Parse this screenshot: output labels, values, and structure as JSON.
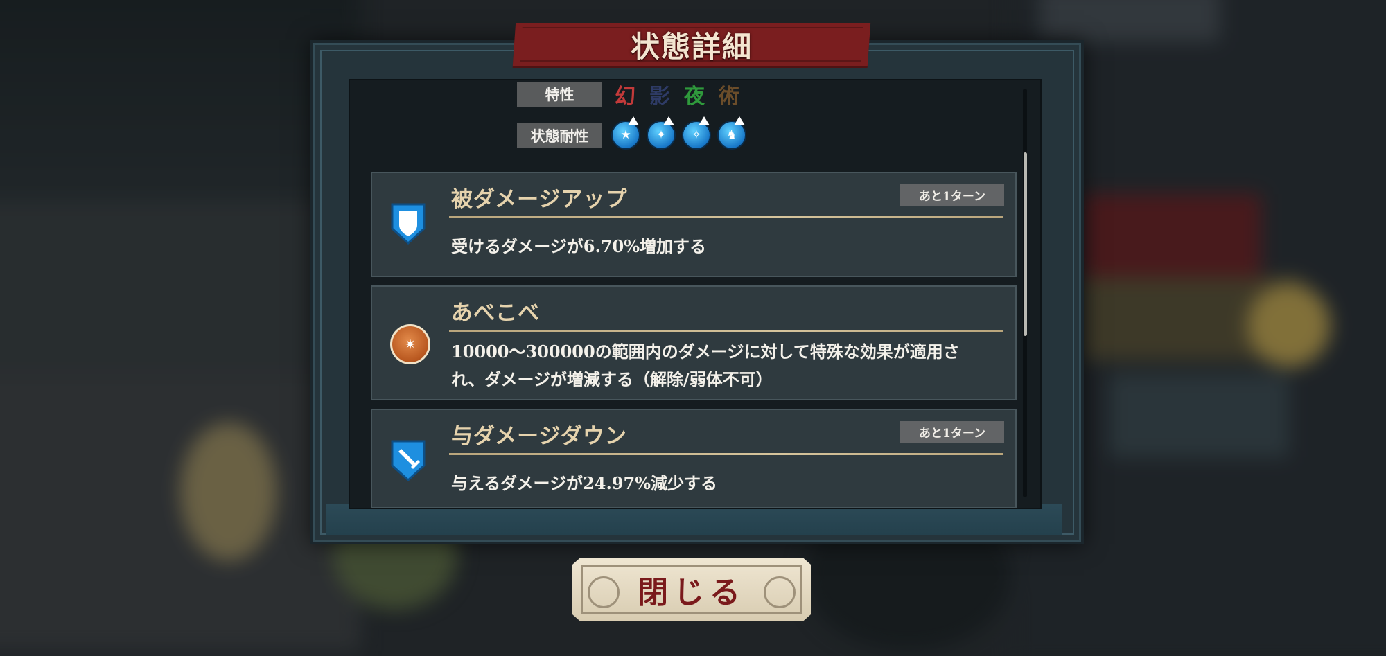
{
  "dialog": {
    "title": "状態詳細",
    "close_label": "閉じる"
  },
  "properties": {
    "trait_label": "特性",
    "trait_glyphs": [
      {
        "char": "幻",
        "color": "#c23a3a"
      },
      {
        "char": "影",
        "color": "#2e3b66"
      },
      {
        "char": "夜",
        "color": "#2f9a3c"
      },
      {
        "char": "術",
        "color": "#6b4d2a"
      }
    ],
    "resist_label": "状態耐性",
    "resist_icons": [
      "stun-star-icon",
      "confuse-star-icon",
      "sleep-star-icon",
      "bind-boot-icon"
    ]
  },
  "statuses": [
    {
      "name": "被ダメージアップ",
      "turns": "あと1ターン",
      "description": "受けるダメージが6.70%増加する",
      "icon": "shield-icon"
    },
    {
      "name": "あべこべ",
      "turns": "",
      "description_line1": "10000～300000の範囲内のダメージに対して特殊な効果が適用さ",
      "description_line2": "れ、ダメージが増減する（解除/弱体不可）",
      "icon": "swap-orb-icon"
    },
    {
      "name": "与ダメージダウン",
      "turns": "あと1ターン",
      "description": "与えるダメージが24.97%減少する",
      "icon": "sword-shield-icon"
    }
  ]
}
